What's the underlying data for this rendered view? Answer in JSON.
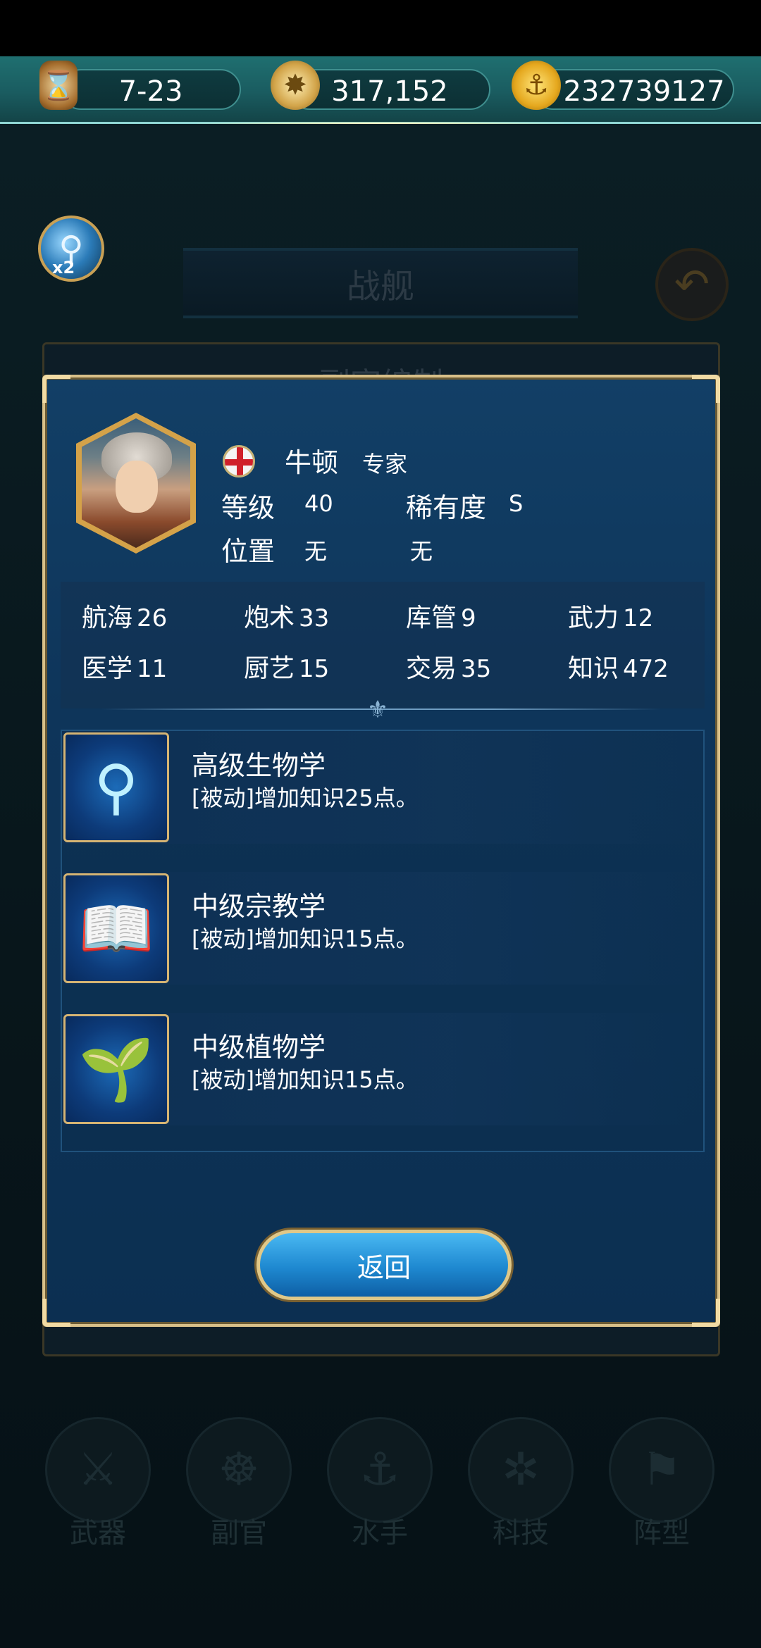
{
  "resources": {
    "date": "7-23",
    "compass_value": "317,152",
    "gold_value": "232739127",
    "icons": [
      "hourglass-icon",
      "compass-icon",
      "anchor-coin-icon"
    ]
  },
  "background": {
    "magnify_badge": "x2",
    "banner_title": "战舰",
    "panel_title": "副官编制",
    "nav": [
      "武器",
      "副官",
      "水手",
      "科技",
      "阵型"
    ]
  },
  "officer": {
    "name": "牛顿",
    "role": "专家",
    "level_label": "等级",
    "level_value": "40",
    "rarity_label": "稀有度",
    "rarity_value": "S",
    "position_label": "位置",
    "position_value_1": "无",
    "position_value_2": "无",
    "flag_colors": {
      "field": "#f5f5f5",
      "cross": "#d0202a"
    }
  },
  "stats": [
    {
      "label": "航海",
      "value": "26"
    },
    {
      "label": "炮术",
      "value": "33"
    },
    {
      "label": "库管",
      "value": "9"
    },
    {
      "label": "武力",
      "value": "12"
    },
    {
      "label": "医学",
      "value": "11"
    },
    {
      "label": "厨艺",
      "value": "15"
    },
    {
      "label": "交易",
      "value": "35"
    },
    {
      "label": "知识",
      "value": "472"
    }
  ],
  "skills": [
    {
      "name": "高级生物学",
      "desc": "[被动]增加知识25点。",
      "icon": "magnifier-icon"
    },
    {
      "name": "中级宗教学",
      "desc": "[被动]增加知识15点。",
      "icon": "book-icon"
    },
    {
      "name": "中级植物学",
      "desc": "[被动]增加知识15点。",
      "icon": "plant-icon"
    }
  ],
  "buttons": {
    "return_label": "返回"
  },
  "colors": {
    "accent_gold": "#d8c089",
    "panel_blue": "#0e355a",
    "button_blue": "#1e88d0"
  }
}
